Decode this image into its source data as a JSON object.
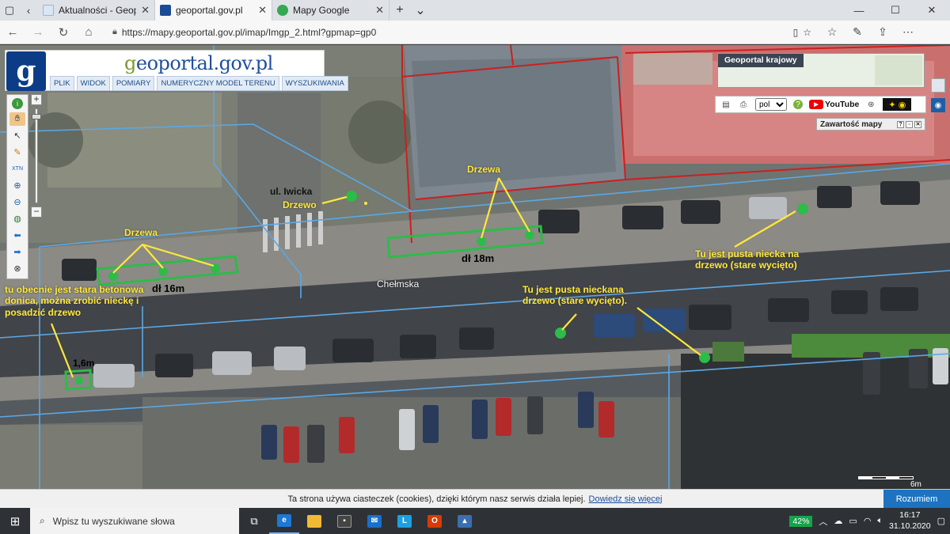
{
  "browser": {
    "tabs": [
      {
        "title": "Aktualności - Geoportal Kra",
        "color": "#d9e6f4"
      },
      {
        "title": "geoportal.gov.pl",
        "color": "#1a4b96",
        "active": true
      },
      {
        "title": "Mapy Google",
        "color": "#34a853"
      }
    ],
    "url": "https://mapy.geoportal.gov.pl/imap/Imgp_2.html?gpmap=gp0"
  },
  "geoportal": {
    "logo_text_prefix": "g",
    "logo_text": "eoportal.gov.pl",
    "menu": [
      "PLIK",
      "WIDOK",
      "POMIARY",
      "NUMERYCZNY MODEL TERENU",
      "WYSZUKIWANIA"
    ],
    "overview_title": "Geoportal krajowy",
    "language": "pol",
    "youtube_label": "YouTube",
    "legend_title": "Zawartość mapy",
    "scale_label": "6m"
  },
  "annotations": {
    "ul_iwicka": "ul. Iwicka",
    "drzewo_left": "Drzewo",
    "drzewa_top": "Drzewa",
    "drzewa_left": "Drzewa",
    "dl_18": "dł 18m",
    "dl_16": "dł 16m",
    "chelmska": "Chełmska",
    "betonowa": [
      "tu obecnie jest stara betonowa",
      "donica, można zrobić nieckę i",
      "posadzić drzewo"
    ],
    "width_16": "1,6m",
    "niecka_mid": [
      "Tu jest pusta nieckana",
      "drzewo (stare wycięto)."
    ],
    "niecka_right": [
      "Tu jest pusta niecka na",
      "drzewo (stare wycięto)"
    ]
  },
  "cookie": {
    "text": "Ta strona używa ciasteczek (cookies), dzięki którym nasz serwis działa lepiej.",
    "link": "Dowiedz się więcej",
    "accept": "Rozumiem"
  },
  "taskbar": {
    "search_placeholder": "Wpisz tu wyszukiwane słowa",
    "battery": "42%",
    "time": "16:17",
    "date": "31.10.2020"
  },
  "colors": {
    "annotation_yellow": "#ffe83a",
    "marker_green": "#2dbb4a",
    "parcel_red": "#cc1f1f",
    "parcel_blue": "#5aa8e6"
  }
}
